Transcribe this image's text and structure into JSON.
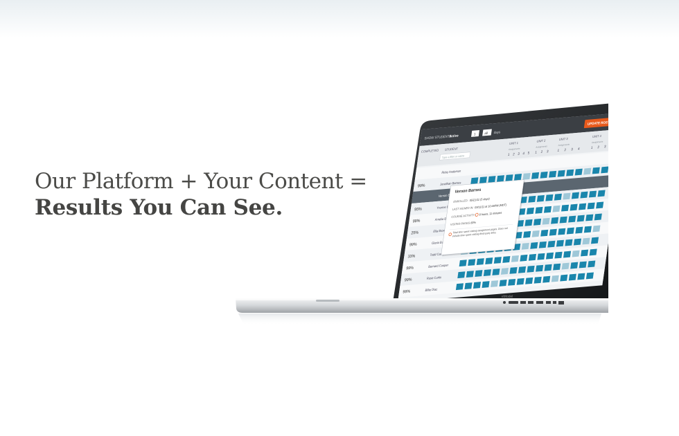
{
  "headline": {
    "line1": "Our Platform + Your Content =",
    "line2": "Results You Can See."
  },
  "screen": {
    "toolbar": {
      "filter_label": "SHOW STUDENTS:",
      "filter_value": "Active",
      "range_from": "1",
      "range_to": "all",
      "range_unit": "days",
      "update_button": "UPDATE ROSTER"
    },
    "columns": {
      "completed": "COMPLETED",
      "student": "STUDENT",
      "filter_placeholder": "Type a filter or name",
      "units": [
        "UNIT 1",
        "UNIT 2",
        "UNIT 3",
        "UNIT 4"
      ],
      "assignments_label": "Assignments",
      "unit_numbers": [
        [
          "1",
          "2",
          "3",
          "4",
          "5"
        ],
        [
          "1",
          "2",
          "3"
        ],
        [
          "1",
          "2",
          "3",
          "4"
        ],
        [
          "1",
          "2",
          "3"
        ]
      ]
    },
    "rows": [
      {
        "completed": "",
        "student": "Ricky Anderson"
      },
      {
        "completed": "99%",
        "student": "Jonathan Barnes"
      },
      {
        "completed": "",
        "student": "Vernon Barnes"
      },
      {
        "completed": "95%",
        "student": "Yvonne Bowman"
      },
      {
        "completed": "99%",
        "student": "Amelia Boyd"
      },
      {
        "completed": "25%",
        "student": "Ella Brown"
      },
      {
        "completed": "99%",
        "student": "Gloria Butler"
      },
      {
        "completed": "33%",
        "student": "Todd Campbell"
      },
      {
        "completed": "99%",
        "student": "Bernard Cooper"
      },
      {
        "completed": "99%",
        "student": "Rose Curtis"
      },
      {
        "completed": "99%",
        "student": "Billie Diaz"
      }
    ],
    "popup": {
      "name": "Vernon Barnes",
      "enrolled_label": "ENROLLED:",
      "enrolled_value": "05/21/11 (5 days)",
      "last_signed_label": "LAST SIGNED IN:",
      "last_signed_value": "03/11/11 at 10:46PM (MDT)",
      "activity_label": "COURSE ACTIVITY:",
      "activity_value": "8 hours, 11 minutes",
      "visited_label": "VISITED PAGES:",
      "visited_value": "83%",
      "note": "Total time spent visiting assignment pages. Does not include time spent visiting third-party links."
    },
    "logo_text": "eModel",
    "colors": {
      "accent_orange": "#e85a1c",
      "cell_teal": "#1a86ac"
    }
  }
}
